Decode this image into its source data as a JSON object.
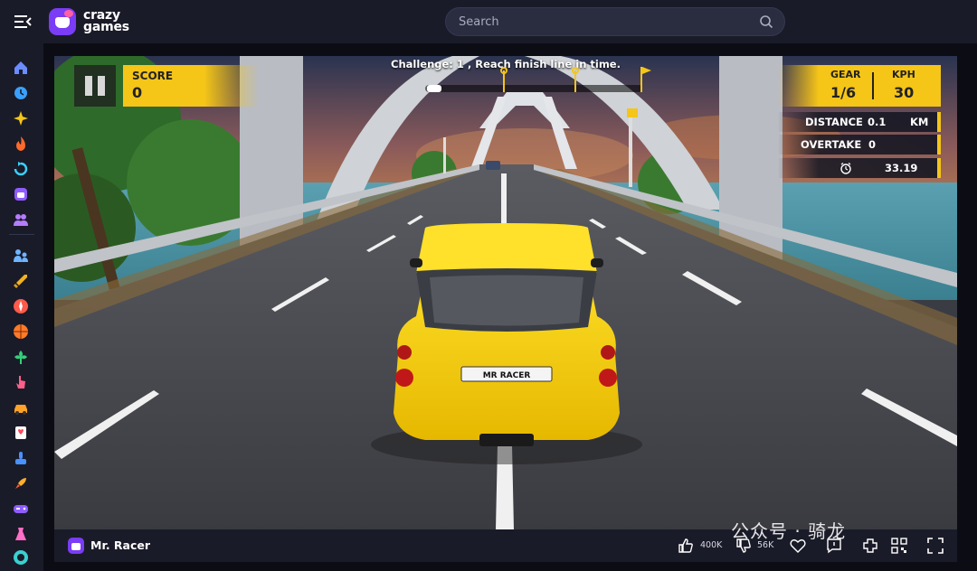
{
  "header": {
    "logo_line1": "crazy",
    "logo_line2": "games",
    "search_placeholder": "Search"
  },
  "sidebar": {
    "items": [
      {
        "name": "home-icon",
        "color": "#6b8cff"
      },
      {
        "name": "recent-clock-icon",
        "color": "#3aa0ff"
      },
      {
        "name": "sparkle-new-icon",
        "color": "#f5c518"
      },
      {
        "name": "fire-trending-icon",
        "color": "#ff6a2a"
      },
      {
        "name": "updated-icon",
        "color": "#3ad1ff"
      },
      {
        "name": "originals-icon",
        "color": "#8f5cff"
      },
      {
        "name": "multiplayer-icon",
        "color": "#b67cff"
      },
      {
        "name": "two-player-icon",
        "color": "#6fb4ff"
      },
      {
        "name": "action-sword-icon",
        "color": "#f5b21e"
      },
      {
        "name": "adventure-compass-icon",
        "color": "#ff5a4a"
      },
      {
        "name": "basketball-icon",
        "color": "#ff7a2a"
      },
      {
        "name": "casual-flower-icon",
        "color": "#34d07a"
      },
      {
        "name": "clicker-icon",
        "color": "#ff5f8a"
      },
      {
        "name": "driving-car-icon",
        "color": "#ffa22a"
      },
      {
        "name": "card-games-icon",
        "color": "#ff4a5a"
      },
      {
        "name": "controller-icon",
        "color": "#4a90ff"
      },
      {
        "name": "rocket-icon",
        "color": "#ffb02a"
      },
      {
        "name": "gamepad-icon",
        "color": "#8f5cff"
      },
      {
        "name": "dress-up-icon",
        "color": "#ff6ec7"
      },
      {
        "name": "io-games-icon",
        "color": "#3ad1d1"
      }
    ]
  },
  "game": {
    "challenge": "Challenge: 1 , Reach finish line in time.",
    "score_label": "SCORE",
    "score_value": "0",
    "gear_label": "GEAR",
    "gear_value": "1/6",
    "kph_label": "KPH",
    "kph_value": "30",
    "distance_label": "DISTANCE",
    "distance_value": "0.1",
    "distance_unit": "KM",
    "overtake_label": "OVERTAKE",
    "overtake_value": "0",
    "timer_value": "33.19",
    "plate_text": "MR RACER"
  },
  "footer": {
    "title": "Mr. Racer",
    "likes": "400K",
    "dislikes": "56K"
  },
  "watermark": "公众号 · 骑龙"
}
